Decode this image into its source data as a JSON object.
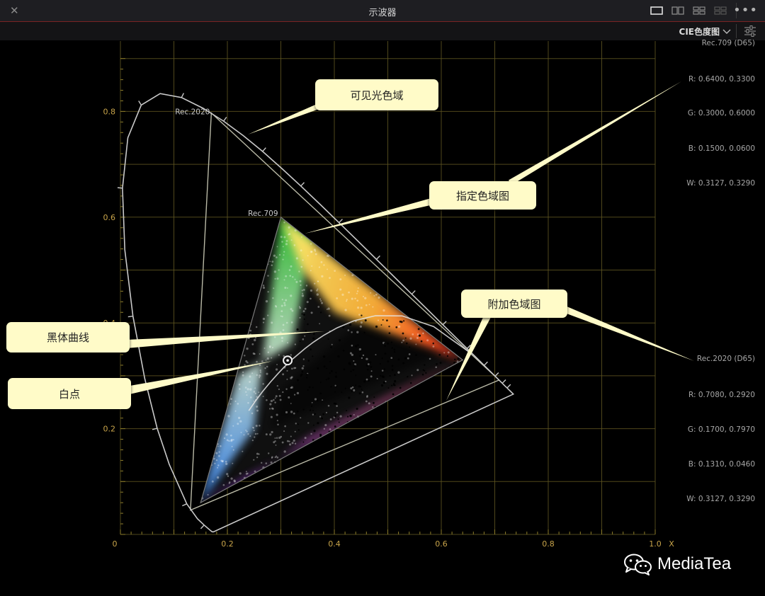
{
  "window": {
    "title": "示波器",
    "close_icon": "close-icon",
    "layout_icons": [
      "single-view-icon",
      "dual-view-icon",
      "quad-view-icon",
      "quad-view-alt-icon"
    ],
    "more_icon": "more-icon"
  },
  "toolbar": {
    "scope_type": "CIE色度图",
    "dropdown_icon": "chevron-down-icon",
    "settings_icon": "settings-sliders-icon"
  },
  "chart_data": {
    "type": "scatter",
    "title": "",
    "xlabel": "X",
    "ylabel": "",
    "xlim": [
      0,
      1.0
    ],
    "ylim": [
      0,
      0.9
    ],
    "x_tick_labels": [
      "0",
      "0.2",
      "0.4",
      "0.6",
      "0.8",
      "1.0"
    ],
    "y_tick_labels": [
      "0.2",
      "0.4",
      "0.6",
      "0.8"
    ],
    "grid": true,
    "gamuts": [
      {
        "name": "Rec.709",
        "primaries": [
          [
            0.64,
            0.33
          ],
          [
            0.3,
            0.6
          ],
          [
            0.15,
            0.06
          ]
        ],
        "white": [
          0.3127,
          0.329
        ]
      },
      {
        "name": "Rec.2020",
        "primaries": [
          [
            0.708,
            0.292
          ],
          [
            0.17,
            0.797
          ],
          [
            0.131,
            0.046
          ]
        ],
        "white": [
          0.3127,
          0.329
        ]
      }
    ],
    "spectral_locus": [
      [
        0.1741,
        0.005
      ],
      [
        0.174,
        0.005
      ],
      [
        0.1733,
        0.0048
      ],
      [
        0.1714,
        0.0051
      ],
      [
        0.1689,
        0.0069
      ],
      [
        0.1644,
        0.0109
      ],
      [
        0.1566,
        0.0177
      ],
      [
        0.144,
        0.0297
      ],
      [
        0.1241,
        0.0578
      ],
      [
        0.0913,
        0.1327
      ],
      [
        0.0687,
        0.2007
      ],
      [
        0.0454,
        0.295
      ],
      [
        0.0235,
        0.4127
      ],
      [
        0.0082,
        0.5384
      ],
      [
        0.0039,
        0.6548
      ],
      [
        0.0139,
        0.7502
      ],
      [
        0.0389,
        0.812
      ],
      [
        0.0743,
        0.8338
      ],
      [
        0.1142,
        0.8262
      ],
      [
        0.1547,
        0.8059
      ],
      [
        0.1929,
        0.7816
      ],
      [
        0.2296,
        0.7543
      ],
      [
        0.2658,
        0.7243
      ],
      [
        0.3016,
        0.6923
      ],
      [
        0.3373,
        0.6589
      ],
      [
        0.3731,
        0.6245
      ],
      [
        0.4087,
        0.5896
      ],
      [
        0.4441,
        0.5547
      ],
      [
        0.4788,
        0.5202
      ],
      [
        0.5125,
        0.4866
      ],
      [
        0.5448,
        0.4544
      ],
      [
        0.5752,
        0.4242
      ],
      [
        0.6029,
        0.3965
      ],
      [
        0.627,
        0.3725
      ],
      [
        0.6482,
        0.3514
      ],
      [
        0.6658,
        0.334
      ],
      [
        0.6801,
        0.3197
      ],
      [
        0.6915,
        0.3083
      ],
      [
        0.7006,
        0.2993
      ],
      [
        0.7079,
        0.292
      ],
      [
        0.714,
        0.2859
      ],
      [
        0.719,
        0.2809
      ],
      [
        0.723,
        0.277
      ],
      [
        0.726,
        0.274
      ],
      [
        0.7283,
        0.2717
      ],
      [
        0.7347,
        0.2653
      ]
    ],
    "blackbody_locus": [
      [
        0.6528,
        0.3444
      ],
      [
        0.5857,
        0.3931
      ],
      [
        0.5267,
        0.4133
      ],
      [
        0.477,
        0.4137
      ],
      [
        0.4369,
        0.4041
      ],
      [
        0.4053,
        0.3907
      ],
      [
        0.3805,
        0.3768
      ],
      [
        0.3608,
        0.3636
      ],
      [
        0.3451,
        0.3516
      ],
      [
        0.3221,
        0.3318
      ],
      [
        0.3064,
        0.3166
      ],
      [
        0.2952,
        0.3048
      ],
      [
        0.2806,
        0.2883
      ],
      [
        0.2658,
        0.2703
      ],
      [
        0.2531,
        0.2531
      ],
      [
        0.24,
        0.234
      ]
    ],
    "annotation_labels": [
      "Rec.2020",
      "Rec.709"
    ]
  },
  "info": {
    "rec709": {
      "title": "Rec.709 (D65)",
      "lines": [
        "R: 0.6400, 0.3300",
        "G: 0.3000, 0.6000",
        "B: 0.1500, 0.0600",
        "W: 0.3127, 0.3290"
      ]
    },
    "rec2020": {
      "title": "Rec.2020 (D65)",
      "lines": [
        "R: 0.7080, 0.2920",
        "G: 0.1700, 0.7970",
        "B: 0.1310, 0.0460",
        "W: 0.3127, 0.3290"
      ]
    }
  },
  "callouts": {
    "visible_gamut": "可见光色域",
    "specified_gamut": "指定色域图",
    "additional_gamut": "附加色域图",
    "blackbody": "黑体曲线",
    "white_point": "白点"
  },
  "watermark": {
    "icon": "wechat-icon",
    "text": "MediaTea"
  }
}
